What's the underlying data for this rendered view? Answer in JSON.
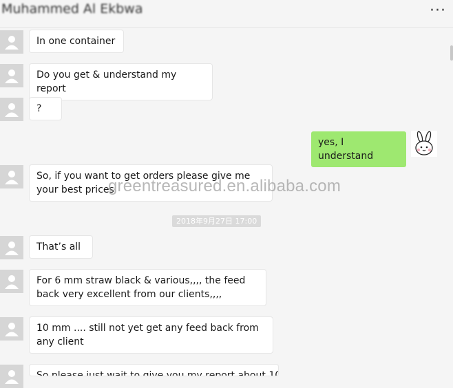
{
  "header": {
    "title": "Muhammed Al Ekbwa",
    "more_icon": "more-dots-icon"
  },
  "messages": [
    {
      "sender": "other",
      "text": "In one container"
    },
    {
      "sender": "other",
      "text": "Do you get & understand my report"
    },
    {
      "sender": "other",
      "text": "?"
    },
    {
      "sender": "me",
      "text": "yes, I understand",
      "sticker": "bunny-sticker"
    },
    {
      "sender": "other",
      "text": "So, if you want to get orders please give me your best prices"
    },
    {
      "sender": "other",
      "text": "That’s all"
    },
    {
      "sender": "other",
      "text": "For 6 mm straw black & various,,,, the feed back very excellent from our clients,,,,"
    },
    {
      "sender": "other",
      "text": "10 mm .... still not yet get any feed back from any client"
    },
    {
      "sender": "other",
      "text": "So please just wait to give you my report about 10"
    }
  ],
  "timestamp": "2018年9月27日 17:00",
  "watermark": "greentreasured.en.alibaba.com",
  "colors": {
    "background": "#f5f5f5",
    "incoming_bubble": "#ffffff",
    "outgoing_bubble": "#9ee870",
    "timestamp_bg": "#dadada"
  }
}
